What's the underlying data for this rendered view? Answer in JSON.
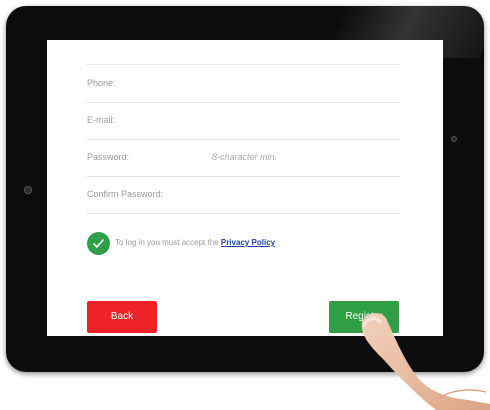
{
  "form": {
    "fields": [
      {
        "label": "Phone:",
        "hint": ""
      },
      {
        "label": "E-mail:",
        "hint": ""
      },
      {
        "label": "Password:",
        "hint": "8-character min."
      },
      {
        "label": "Confirm Password:",
        "hint": ""
      }
    ],
    "policy_text": "To log in you must accept the",
    "policy_link": "Privacy Policy",
    "policy_checked": true,
    "back_label": "Back",
    "register_label": "Register"
  },
  "colors": {
    "back_button": "#ee2328",
    "register_button": "#2f9e44",
    "checkbox": "#2e9e48",
    "link": "#2244aa"
  }
}
